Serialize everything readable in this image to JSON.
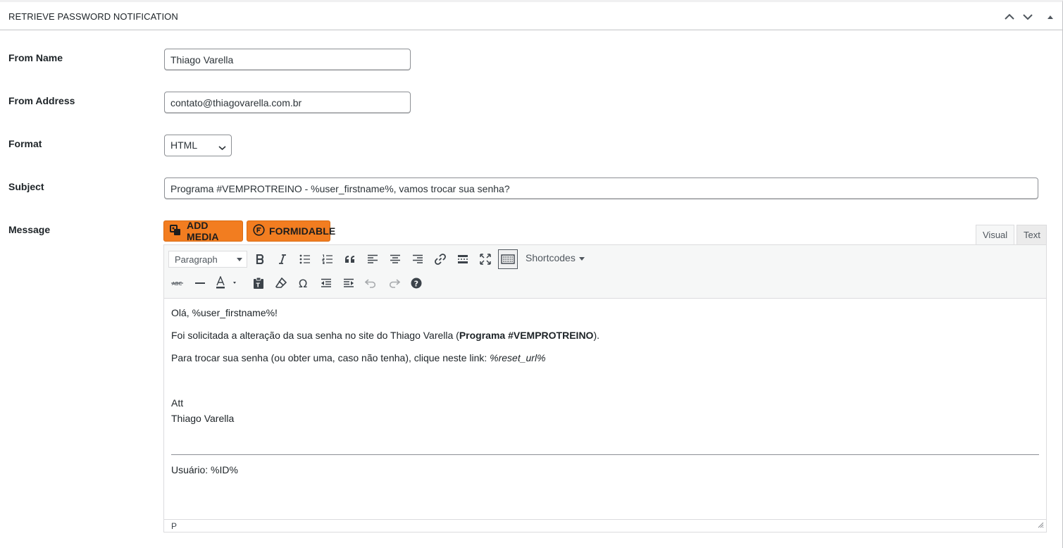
{
  "panel": {
    "title": "RETRIEVE PASSWORD NOTIFICATION",
    "controls": [
      "move-up-icon",
      "move-down-icon",
      "toggle-panel-icon"
    ]
  },
  "form": {
    "from_name": {
      "label": "From Name",
      "value": "Thiago Varella"
    },
    "from_address": {
      "label": "From Address",
      "value": "contato@thiagovarella.com.br"
    },
    "format": {
      "label": "Format",
      "value": "HTML"
    },
    "subject": {
      "label": "Subject",
      "value": "Programa #VEMPROTREINO - %user_firstname%, vamos trocar sua senha?"
    },
    "message": {
      "label": "Message"
    }
  },
  "editor": {
    "buttons": {
      "add_media": "ADD MEDIA",
      "formidable": "FORMIDABLE"
    },
    "tabs": {
      "visual": "Visual",
      "text": "Text"
    },
    "toolbar": {
      "paragraph_select": "Paragraph",
      "shortcodes": "Shortcodes",
      "row1_icons": [
        "bold-icon",
        "italic-icon",
        "bullet-list-icon",
        "numbered-list-icon",
        "blockquote-icon",
        "align-left-icon",
        "align-center-icon",
        "align-right-icon",
        "link-icon",
        "read-more-icon",
        "fullscreen-icon",
        "toolbar-toggle-icon"
      ],
      "row2_icons": [
        "strikethrough-icon",
        "horizontal-line-icon",
        "text-color-icon",
        "paste-text-icon",
        "clear-formatting-icon",
        "special-character-icon",
        "outdent-icon",
        "indent-icon",
        "undo-icon",
        "redo-icon",
        "help-icon"
      ]
    },
    "content": {
      "greeting": "Olá, %user_firstname%!",
      "line2_pre": "Foi solicitada a alteração da sua senha no site do Thiago Varella (",
      "line2_bold": "Programa #VEMPROTREINO",
      "line2_post": ").",
      "line3_pre": "Para trocar sua senha (ou obter uma, caso não tenha), clique neste link: ",
      "line3_italic": "%reset_url%",
      "signoff": "Att",
      "signature": "Thiago Varella",
      "footer": "Usuário: %ID%"
    },
    "statusbar_path": "P"
  },
  "colors": {
    "accent_button": "#f27d20",
    "border": "#8c8f94",
    "toolbar_bg": "#f6f7f7"
  }
}
